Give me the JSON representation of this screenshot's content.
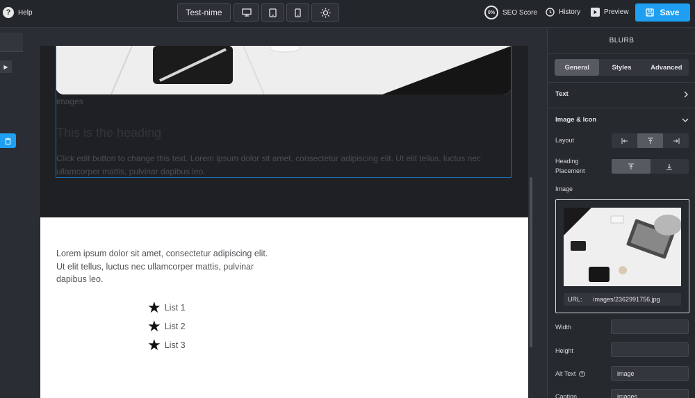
{
  "topbar": {
    "help_label": "Help",
    "page_name": "Test-nime",
    "seo_score_value": "0%",
    "seo_score_label": "SEO Score",
    "history_label": "History",
    "preview_label": "Preview",
    "save_label": "Save"
  },
  "canvas": {
    "image_caption": "images",
    "blurb_heading": "This is the heading",
    "blurb_text": "Click edit button to change this text. Lorem ipsum dolor sit amet, consectetur adipiscing elit. Ut elit tellus, luctus nec ullamcorper mattis, pulvinar dapibus leo.",
    "body_text": "Lorem ipsum dolor sit amet, consectetur adipiscing elit. Ut elit tellus, luctus nec ullamcorper mattis, pulvinar dapibus leo.",
    "list_items": [
      {
        "icon": "star-icon",
        "label": "List 1"
      },
      {
        "icon": "star-icon",
        "label": "List 2"
      },
      {
        "icon": "star-icon",
        "label": "List 3"
      }
    ]
  },
  "panel": {
    "title": "BLURB",
    "tabs": [
      {
        "label": "General",
        "active": true
      },
      {
        "label": "Styles",
        "active": false
      },
      {
        "label": "Advanced",
        "active": false
      }
    ],
    "text_section_label": "Text",
    "image_icon_section_label": "Image & Icon",
    "layout_label": "Layout",
    "heading_placement_label": "Heading Placement",
    "image_label": "Image",
    "url_label": "URL:",
    "url_value": "images/2362991756.jpg",
    "width_label": "Width",
    "width_value": "",
    "height_label": "Height",
    "height_value": "",
    "alt_text_label": "Alt Text",
    "alt_text_value": "image",
    "caption_label": "Caption",
    "caption_value": "images"
  },
  "colors": {
    "accent": "#1e9ff2",
    "selection_outline": "#1e6fb5",
    "panel_bg": "#26292e",
    "dark_section_bg": "#1f2023"
  }
}
